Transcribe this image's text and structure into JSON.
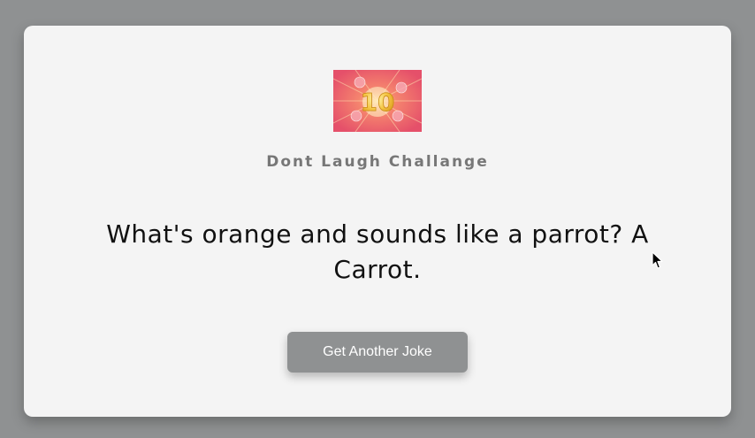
{
  "app": {
    "title": "Dont Laugh Challange"
  },
  "joke": {
    "text": "What's orange and sounds like a parrot? A Carrot."
  },
  "actions": {
    "get_joke_label": "Get Another Joke"
  },
  "hero_image": {
    "icon": "ten-points-burst-icon",
    "accent_colors": [
      "#e85a6e",
      "#f4c542"
    ]
  },
  "colors": {
    "background": "#8f9192",
    "card": "#f4f4f4",
    "title": "#777777",
    "joke_text": "#111111",
    "button": "#8f9192",
    "button_text": "#ffffff"
  }
}
